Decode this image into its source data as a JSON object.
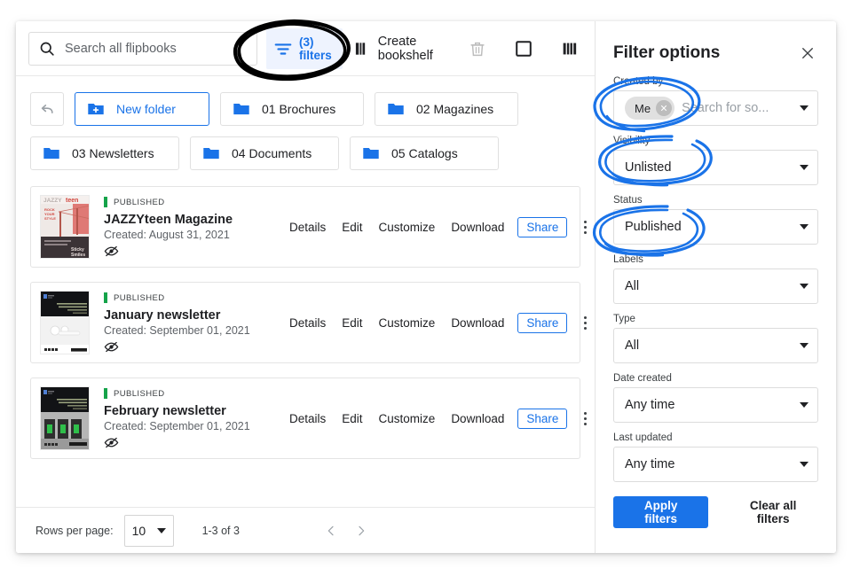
{
  "toolbar": {
    "search_placeholder": "Search all flipbooks",
    "search_value": "",
    "search_icon": "search-icon",
    "filters_count": "(3)",
    "filters_label": "filters",
    "filters_icon": "filter-lines-icon",
    "create_bookshelf_line1": "Create",
    "create_bookshelf_line2": "bookshelf",
    "create_bookshelf_icon": "bookshelf-icon",
    "delete_icon": "trash-icon",
    "select_icon": "empty-checkbox-icon",
    "view_icon": "bookshelf-view-icon"
  },
  "folders": {
    "back_icon": "back-arrow-icon",
    "new_folder_label": "New folder",
    "new_folder_icon": "create-new-folder-icon",
    "items": [
      {
        "label": "01 Brochures",
        "icon": "folder-icon"
      },
      {
        "label": "02 Magazines",
        "icon": "folder-icon"
      },
      {
        "label": "03 Newsletters",
        "icon": "folder-icon"
      },
      {
        "label": "04 Documents",
        "icon": "folder-icon"
      },
      {
        "label": "05 Catalogs",
        "icon": "folder-icon"
      }
    ]
  },
  "list": {
    "actions": {
      "details": "Details",
      "edit": "Edit",
      "customize": "Customize",
      "download": "Download",
      "share": "Share",
      "more_icon": "kebab-menu-icon",
      "visibility_icon": "eye-hidden-icon"
    },
    "items": [
      {
        "status": "PUBLISHED",
        "status_color": "#15a34a",
        "title": "JAZZYteen Magazine",
        "created": "Created: August 31, 2021",
        "thumbnail": "jazzyteen-magazine-cover"
      },
      {
        "status": "PUBLISHED",
        "status_color": "#15a34a",
        "title": "January newsletter",
        "created": "Created: September 01, 2021",
        "thumbnail": "january-newsletter-cover"
      },
      {
        "status": "PUBLISHED",
        "status_color": "#15a34a",
        "title": "February newsletter",
        "created": "Created: September 01, 2021",
        "thumbnail": "february-newsletter-cover"
      }
    ]
  },
  "footer": {
    "rows_per_page_label": "Rows per page:",
    "rows_per_page_value": "10",
    "range_label": "1-3 of 3",
    "prev_icon": "chevron-left-icon",
    "next_icon": "chevron-right-icon"
  },
  "filter_panel": {
    "title": "Filter options",
    "close_icon": "close-icon",
    "fields": [
      {
        "label": "Created by",
        "chip": "Me",
        "chip_remove_icon": "chip-remove-icon",
        "placeholder": "Search for so...",
        "value": ""
      },
      {
        "label": "Visibility",
        "value": "Unlisted"
      },
      {
        "label": "Status",
        "value": "Published"
      },
      {
        "label": "Labels",
        "value": "All"
      },
      {
        "label": "Type",
        "value": "All"
      },
      {
        "label": "Date created",
        "value": "Any time"
      },
      {
        "label": "Last updated",
        "value": "Any time"
      }
    ],
    "apply_label": "Apply filters",
    "clear_label": "Clear all filters",
    "accent_color": "#1a73e8"
  },
  "annotations": {
    "black_circle_target": "filters-button",
    "blue_circle_targets": [
      "created-by-field",
      "visibility-field",
      "status-field"
    ],
    "black_color": "#000000",
    "blue_color": "#1a73e8"
  }
}
